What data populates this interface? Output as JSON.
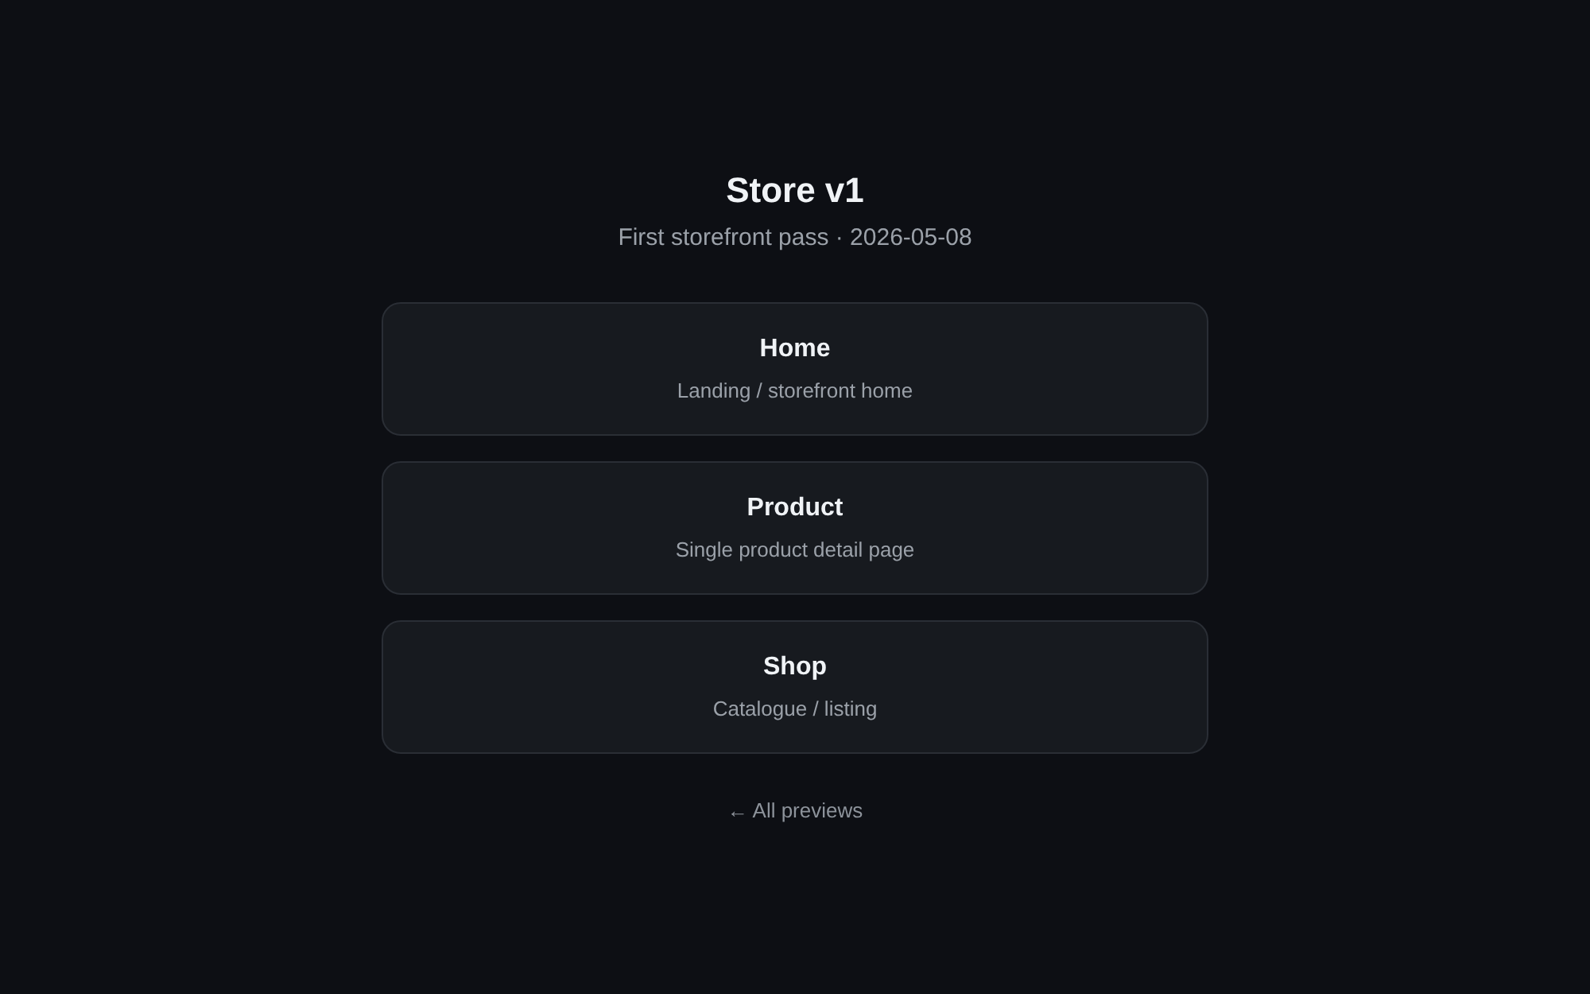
{
  "header": {
    "title": "Store v1",
    "subtitle": "First storefront pass · 2026-05-08"
  },
  "pages": [
    {
      "title": "Home",
      "description": "Landing / storefront home"
    },
    {
      "title": "Product",
      "description": "Single product detail page"
    },
    {
      "title": "Shop",
      "description": "Catalogue / listing"
    }
  ],
  "back_link": "← All previews"
}
